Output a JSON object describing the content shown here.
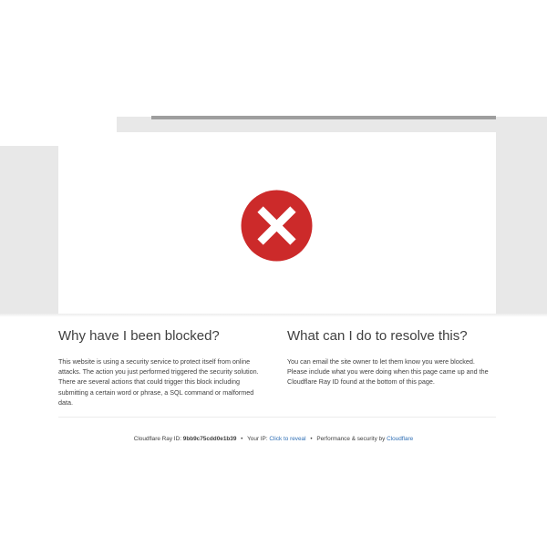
{
  "blocked": {
    "heading": "Why have I been blocked?",
    "body": "This website is using a security service to protect itself from online attacks. The action you just performed triggered the security solution. There are several actions that could trigger this block including submitting a certain word or phrase, a SQL command or malformed data."
  },
  "resolve": {
    "heading": "What can I do to resolve this?",
    "body": "You can email the site owner to let them know you were blocked. Please include what you were doing when this page came up and the Cloudflare Ray ID found at the bottom of this page."
  },
  "footer": {
    "ray_label": "Cloudflare Ray ID:",
    "ray_id": "9bb9c75cdd0e1b39",
    "separator": "•",
    "ip_label": "Your IP:",
    "ip_link": "Click to reveal",
    "perf_label": "Performance & security by",
    "perf_link": "Cloudflare"
  },
  "icons": {
    "error": "error-x-icon"
  },
  "colors": {
    "error_red": "#cc2a2a",
    "link_blue": "#2f6fb5",
    "band_gray": "#e8e8e8"
  }
}
